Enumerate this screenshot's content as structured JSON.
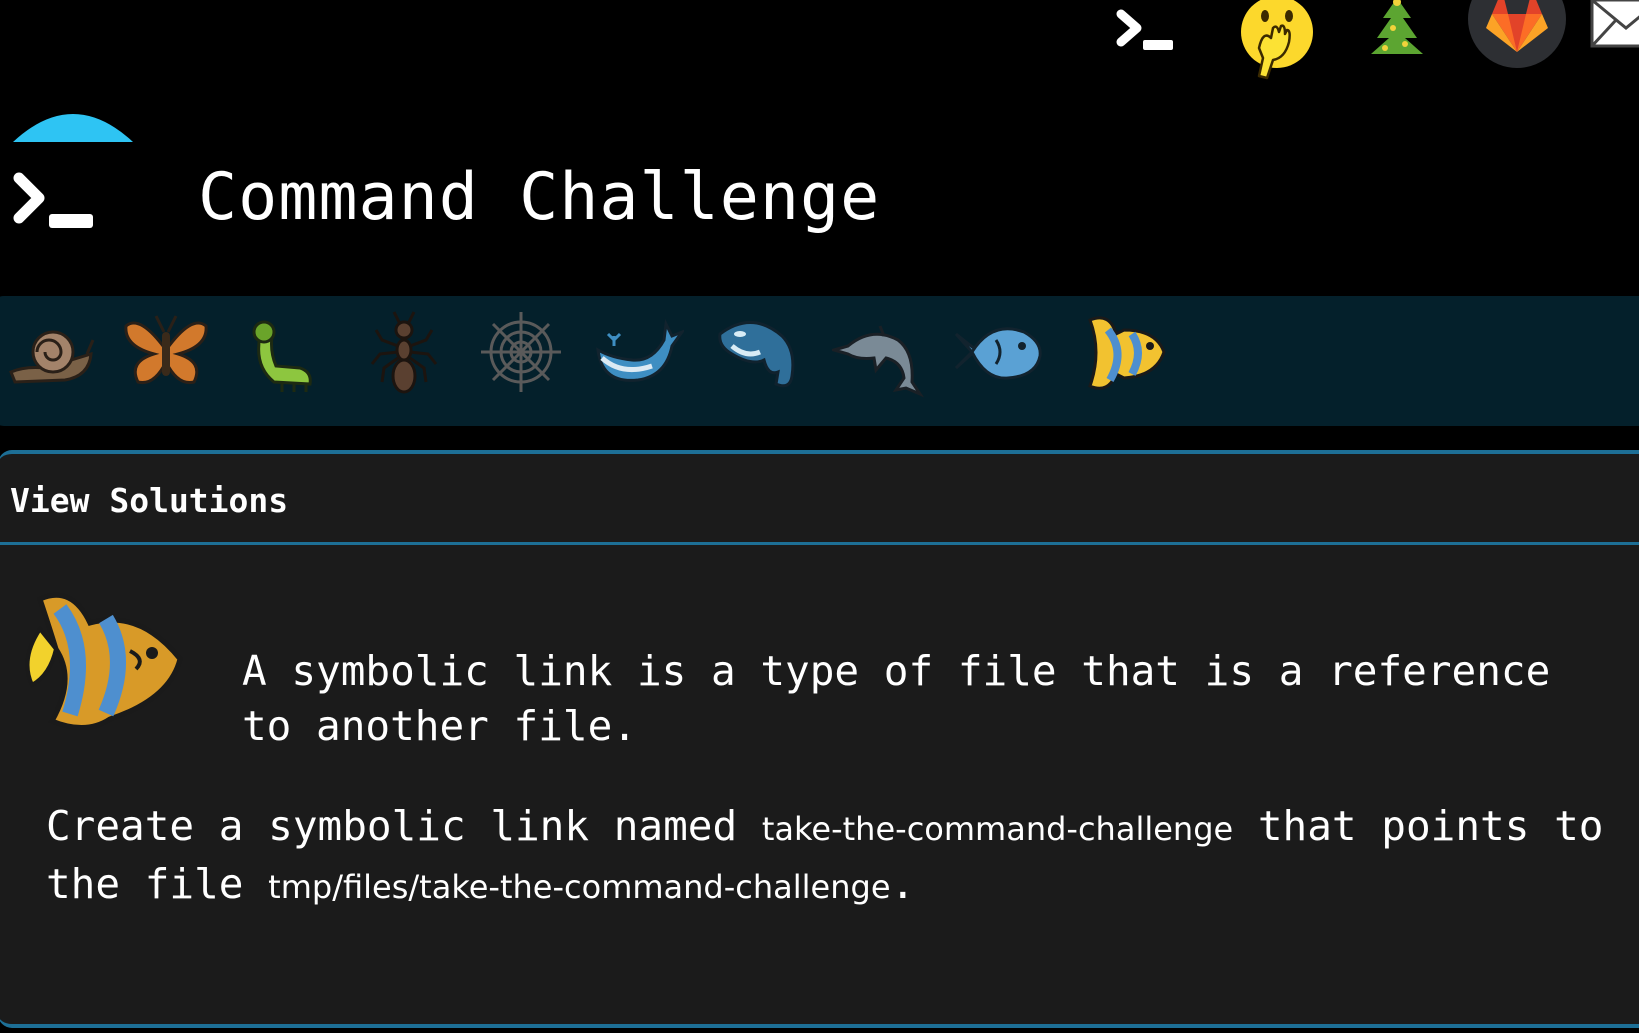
{
  "app": {
    "title": "Command Challenge"
  },
  "topbar": {
    "icons": [
      "terminal-icon",
      "hand-over-mouth-emoji-icon",
      "christmas-tree-icon",
      "gitlab-icon",
      "mail-icon"
    ]
  },
  "levels": {
    "icons": [
      "snail-icon",
      "butterfly-icon",
      "caterpillar-icon",
      "ant-icon",
      "spider-web-icon",
      "whale-icon",
      "orca-icon",
      "dolphin-icon",
      "fish-icon",
      "tropical-fish-icon"
    ],
    "active": "tropical-fish-icon"
  },
  "challenge": {
    "solutions_label": "View Solutions",
    "icon": "tropical-fish-icon",
    "intro": "A symbolic link is a type of file that is a reference to another file.",
    "task_prefix": "Create a symbolic link named ",
    "link_name": "take-the-command-challenge",
    "task_middle": " that points to the file ",
    "target_path": "tmp/files/take-the-command-challenge",
    "task_suffix": "."
  },
  "colors": {
    "background": "#000000",
    "strip": "#04202b",
    "card": "#1b1b1b",
    "accent": "#1d6f96",
    "logo_dome": "#2ec4f3"
  }
}
